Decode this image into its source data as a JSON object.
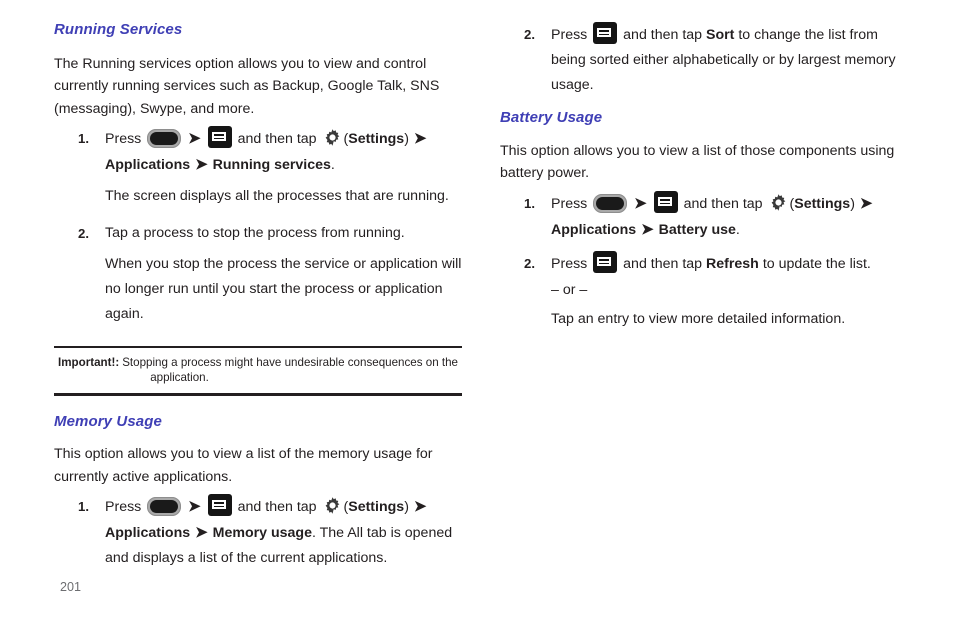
{
  "page": {
    "number": "201",
    "heading_color": "#3f3fb5",
    "text_color": "#231f20",
    "background": "#ffffff"
  },
  "icons": {
    "home_key": "home-key-icon",
    "menu_key": "menu-key-icon",
    "gear": "gear-icon",
    "arrow": "➜"
  },
  "left_column": {
    "running_services": {
      "heading": "Running Services",
      "intro": "The Running services option allows you to view and control currently running services such as Backup, Google Talk, SNS (messaging), Swype, and more.",
      "steps": [
        {
          "number": "1.",
          "press_label": "Press",
          "and_then_tap": "and then tap",
          "paren_open": "(",
          "settings_label": "Settings",
          "paren_close": ")",
          "path_first": "Applications",
          "path_second": "Running services",
          "period": ".",
          "follow_up": "The screen displays all the processes that are running."
        },
        {
          "number": "2.",
          "text": "Tap a process to stop the process from running.",
          "follow_up": "When you stop the process the service or application will no longer run until you start the process or application again."
        }
      ],
      "note": {
        "label": "Important!:",
        "text": "Stopping a process might have undesirable consequences on the",
        "text_cont": "application."
      }
    },
    "memory_usage": {
      "heading": "Memory Usage",
      "intro": "This option allows you to view a list of the memory usage for currently active applications.",
      "steps": [
        {
          "number": "1.",
          "press_label": "Press",
          "and_then_tap": "and then tap",
          "paren_open": "(",
          "settings_label": "Settings",
          "paren_close": ")",
          "path_first": "Applications",
          "path_second": "Memory usage",
          "tail": ". The All tab is opened and displays a list of the current applications."
        }
      ]
    }
  },
  "right_column": {
    "memory_usage_cont": {
      "steps": [
        {
          "number": "2.",
          "press_label": "Press",
          "and_then_tap": "and then tap",
          "action_label": "Sort",
          "tail": "to change the list from being sorted either alphabetically or by largest memory usage."
        }
      ]
    },
    "battery_usage": {
      "heading": "Battery Usage",
      "intro": "This option allows you to view a list of those components using battery power.",
      "steps": [
        {
          "number": "1.",
          "press_label": "Press",
          "and_then_tap": "and then tap",
          "paren_open": "(",
          "settings_label": "Settings",
          "paren_close": ")",
          "path_first": "Applications",
          "path_second": "Battery use",
          "period": "."
        },
        {
          "number": "2.",
          "press_label": "Press",
          "and_then_tap": "and then tap",
          "action_label": "Refresh",
          "tail": "to update the list.",
          "or_separator": "– or –",
          "follow_up": "Tap an entry to view more detailed information."
        }
      ]
    }
  }
}
